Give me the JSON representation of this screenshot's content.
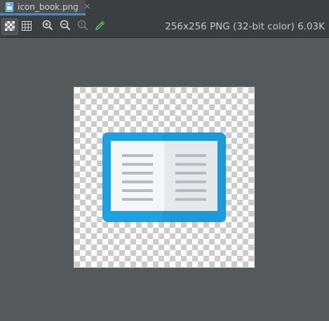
{
  "tab": {
    "filename": "icon_book.png",
    "close_glyph": "✕",
    "icon": "image-file-icon"
  },
  "toolbar": {
    "buttons": [
      {
        "name": "chessboard-toggle",
        "icon": "chessboard-icon",
        "active": true
      },
      {
        "name": "grid-toggle",
        "icon": "grid-icon",
        "active": false
      },
      {
        "name": "zoom-in",
        "icon": "zoom-in-icon",
        "active": false
      },
      {
        "name": "zoom-out",
        "icon": "zoom-out-icon",
        "active": false
      },
      {
        "name": "actual-size",
        "icon": "zoom-actual-icon",
        "active": false
      },
      {
        "name": "color-picker",
        "icon": "eyedropper-icon",
        "active": false
      }
    ],
    "image_info": "256x256 PNG (32-bit color) 6.03K"
  },
  "image": {
    "icon": "open-book-icon",
    "colors": {
      "cover": "#1da1e0",
      "left_page": "#f5f6f7",
      "right_page": "#e6e9eb",
      "lines": "#b4bcc2"
    }
  }
}
